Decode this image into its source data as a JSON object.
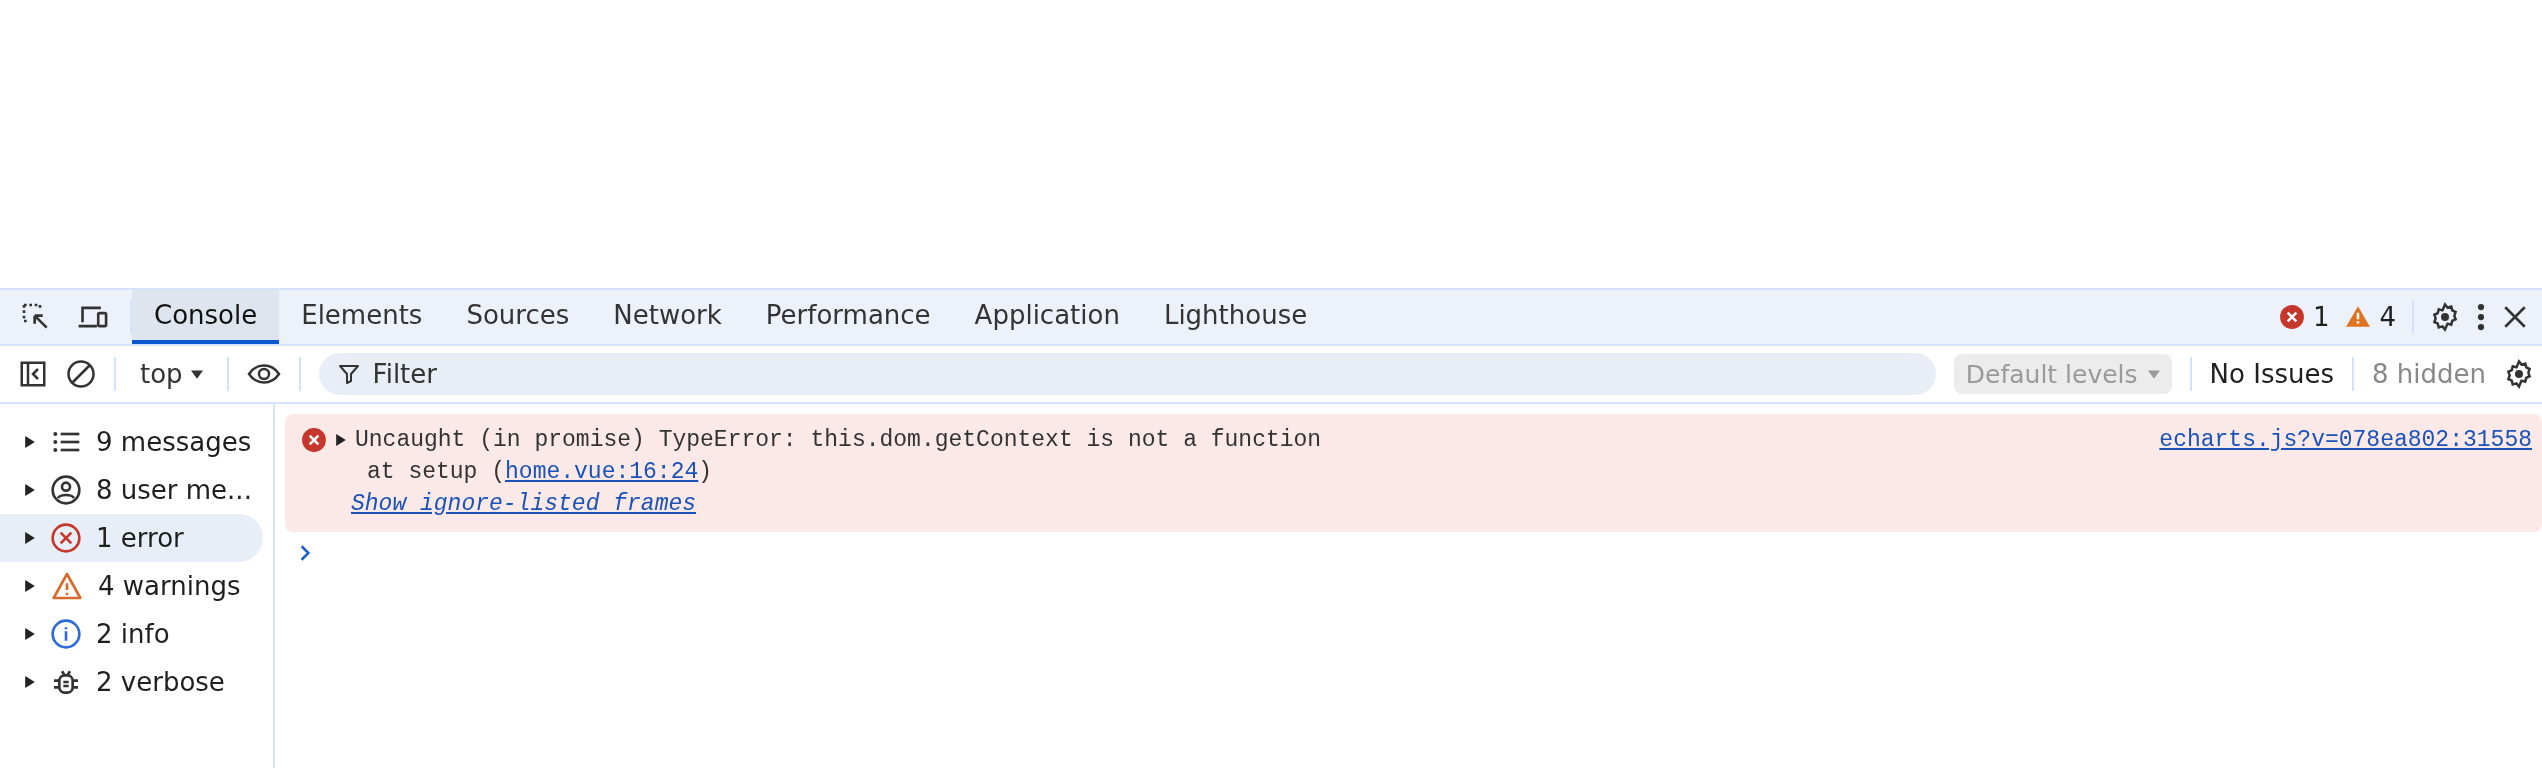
{
  "tabs": [
    {
      "label": "Console",
      "selected": true
    },
    {
      "label": "Elements",
      "selected": false
    },
    {
      "label": "Sources",
      "selected": false
    },
    {
      "label": "Network",
      "selected": false
    },
    {
      "label": "Performance",
      "selected": false
    },
    {
      "label": "Application",
      "selected": false
    },
    {
      "label": "Lighthouse",
      "selected": false
    }
  ],
  "counters": {
    "errors": "1",
    "warnings": "4"
  },
  "toolbar": {
    "context": "top",
    "filter": {
      "placeholder": "Filter"
    },
    "levels": {
      "label": "Default levels",
      "disabled": true
    },
    "issues": "No Issues",
    "hidden": "8 hidden"
  },
  "sidebar": {
    "items": [
      {
        "kind": "messages",
        "label": "9 messages",
        "selected": false,
        "expanded": false
      },
      {
        "kind": "user",
        "label": "8 user me...",
        "selected": false,
        "expanded": false
      },
      {
        "kind": "error",
        "label": "1 error",
        "selected": true,
        "expanded": false
      },
      {
        "kind": "warning",
        "label": "4 warnings",
        "selected": false,
        "expanded": false
      },
      {
        "kind": "info",
        "label": "2 info",
        "selected": false,
        "expanded": false
      },
      {
        "kind": "verbose",
        "label": "2 verbose",
        "selected": false,
        "expanded": false
      }
    ]
  },
  "messages": [
    {
      "kind": "error",
      "expanded": false,
      "text": "Uncaught (in promise) TypeError: this.dom.getContext is not a function",
      "source": "echarts.js?v=078ea802:31558",
      "stack_prefix": "at setup (",
      "stack_link": "home.vue:16:24",
      "stack_suffix": ")",
      "ignore_link": "Show ignore-listed frames"
    }
  ]
}
